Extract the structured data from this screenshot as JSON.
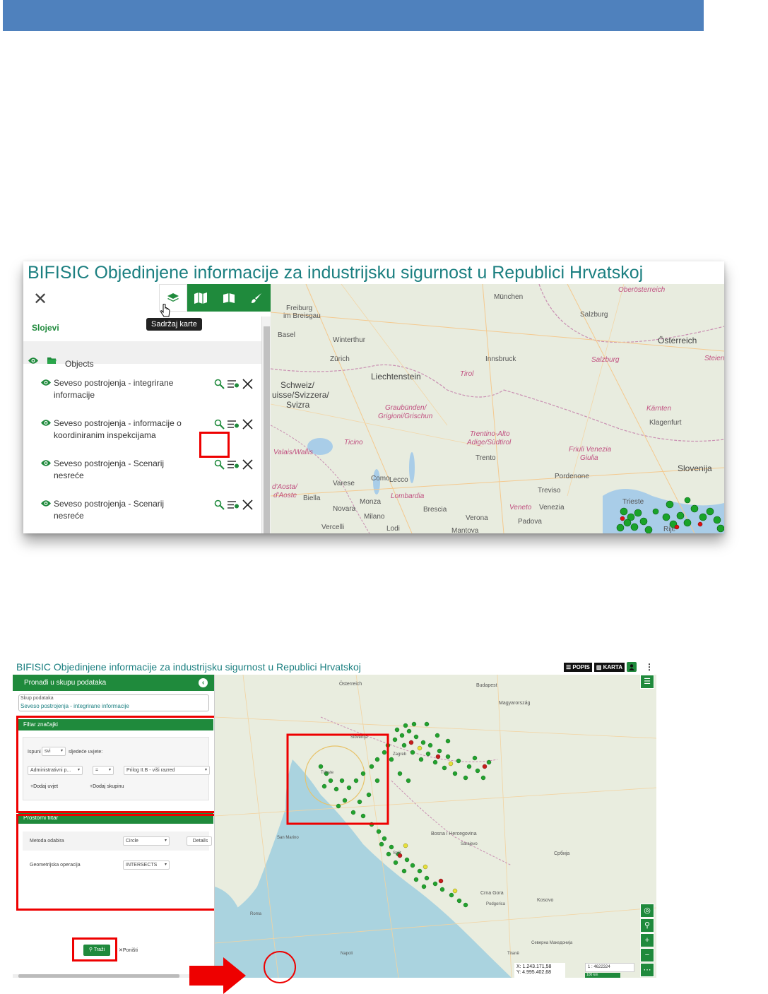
{
  "shot1": {
    "app_title": "BIFISIC Objedinjene informacije za industrijsku sigurnost u Republici Hrvatskoj",
    "close_glyph": "✕",
    "tooltip": "Sadržaj karte",
    "section_title": "Slojevi",
    "group_label": "Objects",
    "layers": [
      {
        "line1": "Seveso postrojenja - integrirane",
        "line2": "informacije"
      },
      {
        "line1": "Seveso postrojenja - informacije o",
        "line2": "koordiniranim inspekcijama"
      },
      {
        "line1": "Seveso postrojenja - Scenarij",
        "line2": "nesreće"
      },
      {
        "line1": "Seveso postrojenja - Scenarij",
        "line2": "nesreće"
      }
    ],
    "map_labels": {
      "oberosterreich": "Oberösterreich",
      "munchen": "München",
      "freiburg": "Freiburg",
      "breisgau": "im Breisgau",
      "salzburg": "Salzburg",
      "basel": "Basel",
      "winterthur": "Winterthur",
      "osterreich": "Österreich",
      "zurich": "Zürich",
      "innsbruck": "Innsbruck",
      "salzburg2": "Salzburg",
      "steiermark": "Steierm",
      "liechtenstein": "Liechtenstein",
      "schweiz1": "Schweiz/",
      "schweiz2": "uisse/Svizzera/",
      "schweiz3": "Svizra",
      "tirol": "Tirol",
      "graubunden1": "Graubünden/",
      "graubunden2": "Grigioni/Grischun",
      "karnten": "Kärnten",
      "klagenfurt": "Klagenfurt",
      "trentino1": "Trentino-Alto",
      "trentino2": "Adige/Südtirol",
      "valais": "Valais/Wallis",
      "ticino": "Ticino",
      "friuli1": "Friuli Venezia",
      "friuli2": "Giulia",
      "trento": "Trento",
      "slovenija": "Slovenija",
      "aosta1": "d'Aosta/",
      "aosta2": "d'Aoste",
      "como": "Como",
      "lecco": "Lecco",
      "varese": "Varese",
      "pordenone": "Pordenone",
      "lombardia": "Lombardia",
      "treviso": "Treviso",
      "biella": "Biella",
      "monza": "Monza",
      "brescia": "Brescia",
      "veneto": "Veneto",
      "venezia": "Venezia",
      "trieste": "Trieste",
      "novara": "Novara",
      "milano": "Milano",
      "verona": "Verona",
      "padova": "Padova",
      "vercelli": "Vercelli",
      "lodi": "Lodi",
      "mantova": "Mantova",
      "rije": "Rije"
    }
  },
  "shot2": {
    "app_title": "BIFISIC Objedinjene informacije za industrijsku sigurnost u Republici Hrvatskoj",
    "badge_popis": "☰ POPIS",
    "badge_karta": "▥ KARTA",
    "panel_title": "Pronađi u skupu podataka",
    "dataset_label": "Skup podataka",
    "dataset_value": "Seveso postrojenja - integrirane informacije",
    "filter_section": "Filtar značajki",
    "ispuni": "Ispuni",
    "svi": "svi",
    "sljedece": "sljedeće uvjete:",
    "cond_field": "Administrativni p...",
    "cond_op": "=",
    "cond_value": "Prilog II.B - viši razred",
    "add_condition": "Dodaj uvjet",
    "add_group": "Dodaj skupinu",
    "spatial_section": "Prostorni filtar",
    "method_label": "Metoda odabira",
    "method_value": "Circle",
    "details_btn": "Details",
    "geom_label": "Geometrijska operacija",
    "geom_value": "INTERSECTS",
    "search_btn": "Traži",
    "reset_btn": "Poništi",
    "coords_x": "X: 1.243.171,58",
    "coords_y": "Y: 4.995.402,68",
    "scale_value": "1 : 4622324",
    "scale_bar": "100 km",
    "map_labels": {
      "osterreich": "Österreich",
      "budapest": "Budapest",
      "magyarorszag": "Magyarország",
      "slovenija": "Slovenija",
      "bosna": "Bosna i Hercegovina",
      "sarajevo": "Sarajevo",
      "crna_gora": "Crna Gora",
      "podgorica": "Podgorica",
      "kosovo": "Kosovo",
      "srbija": "Србија",
      "makedonija": "Северна Македонија",
      "trieste": "Trieste",
      "zagreb": "Zagreb",
      "split": "Split",
      "roma": "Roma",
      "napoli": "Napoli",
      "tirane": "Tiranë",
      "san_marino": "San Marino"
    }
  },
  "colors": {
    "accent_green": "#1f8a3c",
    "header_blue": "#4f81bd",
    "title_teal": "#1b7f80",
    "highlight_red": "#e00000"
  },
  "icons": [
    "close-icon",
    "layers-icon",
    "map-icon",
    "book-map-icon",
    "brush-icon",
    "eye-icon",
    "folder-icon",
    "search-icon",
    "filter-icon",
    "remove-icon",
    "back-icon",
    "pointer-cursor-icon",
    "red-arrow-icon"
  ]
}
